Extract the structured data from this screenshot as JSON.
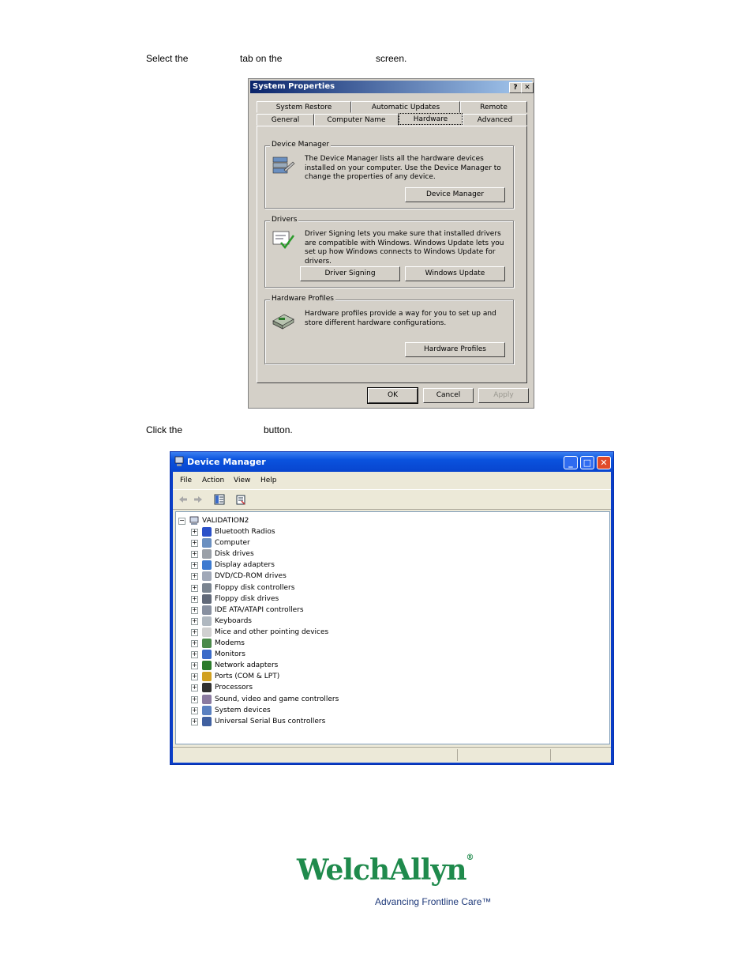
{
  "instruction1": {
    "part1": "Select the",
    "part2": "tab on the",
    "part3": "screen."
  },
  "instruction2": {
    "part1": "Click the",
    "part2": "button."
  },
  "system_properties": {
    "title": "System Properties",
    "help_btn": "?",
    "close_btn": "✕",
    "tabs_row1": [
      "System Restore",
      "Automatic Updates",
      "Remote"
    ],
    "tabs_row2": [
      "General",
      "Computer Name",
      "Hardware",
      "Advanced"
    ],
    "active_tab": "Hardware",
    "device_manager": {
      "label": "Device Manager",
      "text": "The Device Manager lists all the hardware devices installed on your computer. Use the Device Manager to change the properties of any device.",
      "button": "Device Manager"
    },
    "drivers": {
      "label": "Drivers",
      "text": "Driver Signing lets you make sure that installed drivers are compatible with Windows. Windows Update lets you set up how Windows connects to Windows Update for drivers.",
      "button1": "Driver Signing",
      "button2": "Windows Update"
    },
    "hardware_profiles": {
      "label": "Hardware Profiles",
      "text": "Hardware profiles provide a way for you to set up and store different hardware configurations.",
      "button": "Hardware Profiles"
    },
    "ok": "OK",
    "cancel": "Cancel",
    "apply": "Apply"
  },
  "device_manager_window": {
    "title": "Device Manager",
    "menu": [
      "File",
      "Action",
      "View",
      "Help"
    ],
    "root": "VALIDATION2",
    "categories": [
      "Bluetooth Radios",
      "Computer",
      "Disk drives",
      "Display adapters",
      "DVD/CD-ROM drives",
      "Floppy disk controllers",
      "Floppy disk drives",
      "IDE ATA/ATAPI controllers",
      "Keyboards",
      "Mice and other pointing devices",
      "Modems",
      "Monitors",
      "Network adapters",
      "Ports (COM & LPT)",
      "Processors",
      "Sound, video and game controllers",
      "System devices",
      "Universal Serial Bus controllers"
    ],
    "expander_collapsed": "+",
    "expander_expanded": "−"
  },
  "logo": {
    "brand": "WelchAllyn",
    "registered": "®",
    "tagline": "Advancing Frontline Care™"
  },
  "colors": {
    "brand_green": "#1f8a4c",
    "tagline_blue": "#1f3a7a",
    "xp_title_blue": "#0a52de",
    "classic_title": "#0a246a"
  }
}
